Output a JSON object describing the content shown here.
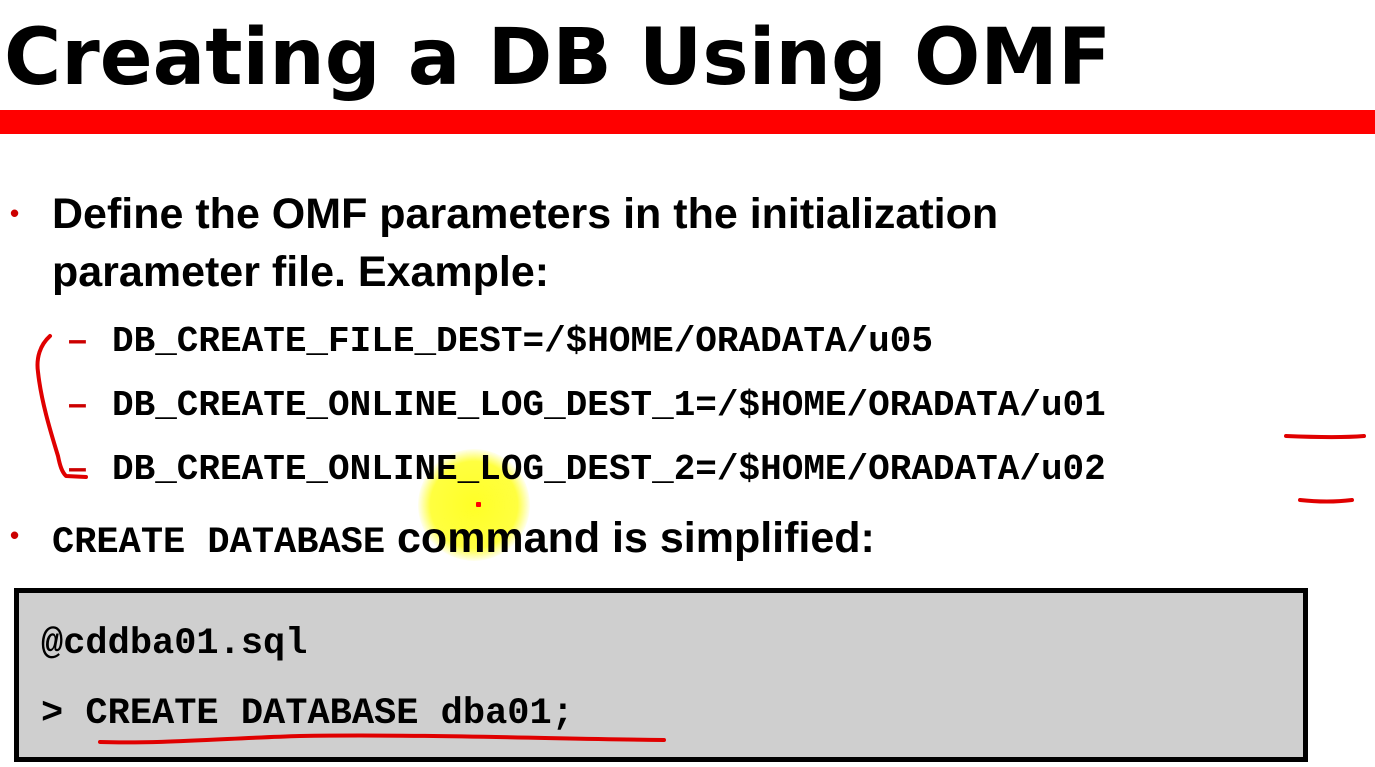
{
  "slide": {
    "title": "Creating a DB Using OMF",
    "bullets": [
      {
        "marker": "•",
        "text_line1": "Define the OMF parameters in the initialization",
        "text_line2": "parameter file. Example:",
        "sub_items": [
          {
            "marker": "–",
            "code": "DB_CREATE_FILE_DEST=/$HOME/ORADATA/u05"
          },
          {
            "marker": "–",
            "code": "DB_CREATE_ONLINE_LOG_DEST_1=/$HOME/ORADATA/u01"
          },
          {
            "marker": "–",
            "code": "DB_CREATE_ONLINE_LOG_DEST_2=/$HOME/ORADATA/u02"
          }
        ]
      },
      {
        "marker": "•",
        "code_part": "CREATE DATABASE",
        "text_part": " command is simplified:"
      }
    ],
    "code_box": {
      "line1": "@cddba01.sql",
      "line2": "> CREATE DATABASE dba01;"
    }
  },
  "colors": {
    "accent_red": "#ff0000",
    "bullet_red": "#cc0000",
    "code_box_bg": "#cfcfcf",
    "highlight_yellow": "#ffff00",
    "annotation_red": "#e00000"
  },
  "icons": {
    "cursor_highlight": "yellow-cursor-spotlight"
  }
}
